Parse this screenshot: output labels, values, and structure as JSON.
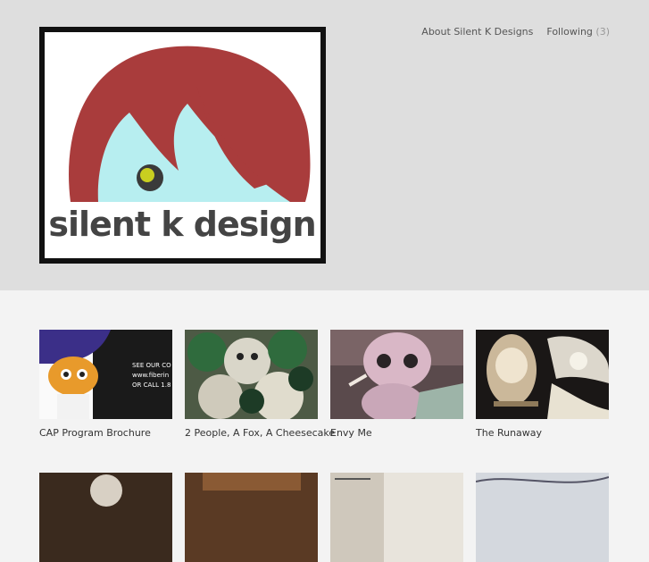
{
  "nav": {
    "about_label": "About Silent K Designs",
    "following_label": "Following",
    "following_count": "(3)"
  },
  "logo": {
    "text": "silent k design"
  },
  "projects": [
    {
      "title": "CAP Program Brochure",
      "overlay_lines": [
        "SEE OUR CO",
        "www.fiberin",
        "OR CALL 1.8"
      ]
    },
    {
      "title": "2 People, A Fox, A Cheesecake"
    },
    {
      "title": "Envy Me"
    },
    {
      "title": "The Runaway"
    }
  ],
  "colors": {
    "header_bg": "#dedede",
    "page_bg": "#f3f3f3",
    "logo_hair": "#a93c3c",
    "logo_face": "#b7eef0",
    "logo_eye": "#c9cf20"
  }
}
